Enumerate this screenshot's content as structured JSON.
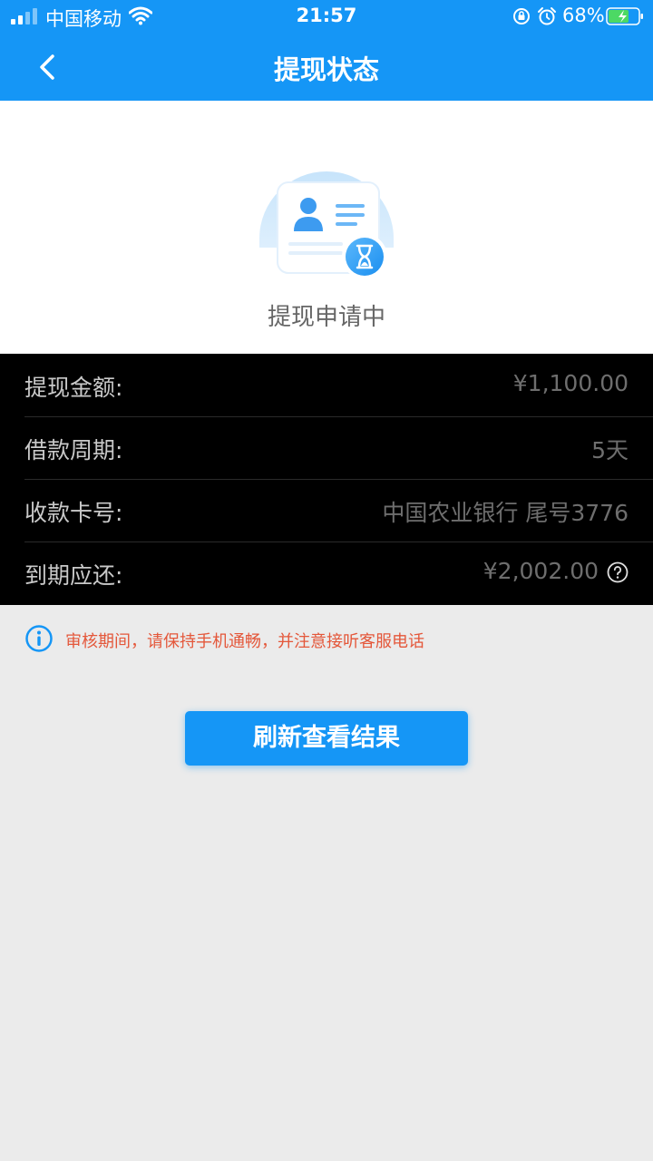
{
  "status_bar": {
    "carrier": "中国移动",
    "time": "21:57",
    "battery_pct": "68%"
  },
  "nav": {
    "title": "提现状态"
  },
  "status": {
    "text": "提现申请中"
  },
  "details": [
    {
      "label": "提现金额:",
      "value": "¥1,100.00"
    },
    {
      "label": "借款周期:",
      "value": "5天"
    },
    {
      "label": "收款卡号:",
      "value": "中国农业银行 尾号3776"
    },
    {
      "label": "到期应还:",
      "value": "¥2,002.00"
    }
  ],
  "notice": {
    "text": "审核期间，请保持手机通畅，并注意接听客服电话"
  },
  "refresh_button": {
    "label": "刷新查看结果"
  },
  "colors": {
    "brand_blue": "#1596f6",
    "notice_red": "#e4573a"
  }
}
